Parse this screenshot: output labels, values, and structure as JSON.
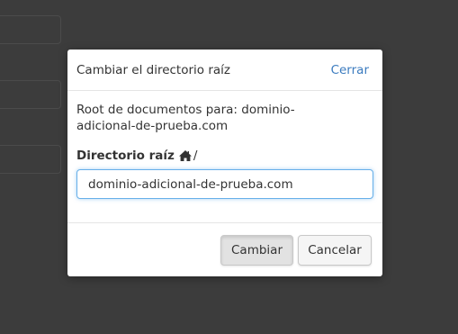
{
  "dialog": {
    "title": "Cambiar el directorio raíz",
    "close_label": "Cerrar",
    "description": "Root de documentos para: dominio-adicional-de-prueba.com",
    "field_label": "Directorio raíz",
    "path_separator": "/",
    "input_value": "dominio-adicional-de-prueba.com",
    "submit_label": "Cambiar",
    "cancel_label": "Cancelar"
  },
  "icons": {
    "home": "home-icon"
  },
  "colors": {
    "backdrop": "#3c3c3c",
    "link": "#3b7bbf",
    "input_focus_border": "#66afe9"
  }
}
